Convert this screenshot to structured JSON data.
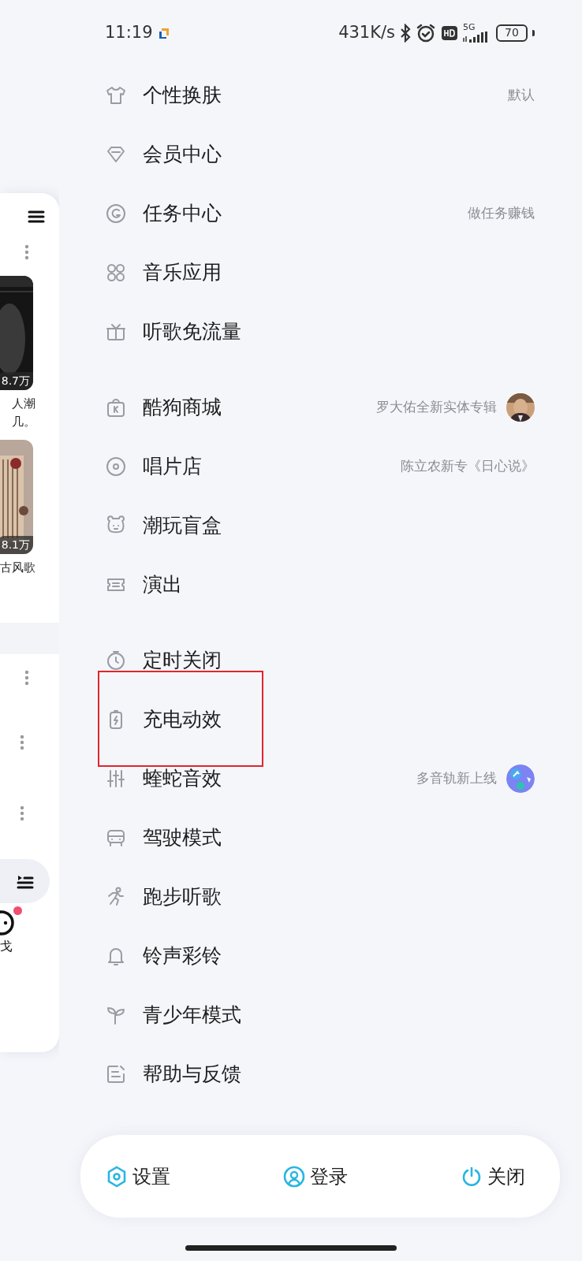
{
  "status_bar": {
    "time": "11:19",
    "net_speed": "431K/s",
    "network": "5G",
    "battery": "70"
  },
  "background_page": {
    "play_counts": [
      "8.7万",
      "8.1万"
    ],
    "captions": [
      "人潮",
      "几。",
      "古风歌"
    ],
    "tab_label": "戈",
    "tab_has_dot": true
  },
  "menu_groups": [
    [
      {
        "kind": "plain",
        "label": "个性换肤",
        "detail": "默认"
      },
      {
        "kind": "plain",
        "label": "会员中心"
      },
      {
        "kind": "plain",
        "label": "任务中心",
        "detail": "做任务赚钱"
      },
      {
        "kind": "plain",
        "label": "音乐应用"
      },
      {
        "kind": "plain",
        "label": "听歌免流量"
      }
    ],
    [
      {
        "kind": "picture",
        "label": "酷狗商城",
        "detail": "罗大佑全新实体专辑"
      },
      {
        "kind": "plain",
        "label": "唱片店",
        "detail": "陈立农新专《日心说》"
      },
      {
        "kind": "plain",
        "label": "潮玩盲盒"
      },
      {
        "kind": "plain",
        "label": "演出"
      }
    ],
    [
      {
        "kind": "plain",
        "label": "定时关闭"
      },
      {
        "kind": "plain",
        "label": "充电动效",
        "annotated": true
      },
      {
        "kind": "badge",
        "label": "蝰蛇音效",
        "detail": "多音轨新上线"
      },
      {
        "kind": "plain",
        "label": "驾驶模式"
      },
      {
        "kind": "plain",
        "label": "跑步听歌"
      },
      {
        "kind": "plain",
        "label": "铃声彩铃"
      },
      {
        "kind": "plain",
        "label": "青少年模式"
      },
      {
        "kind": "plain",
        "label": "帮助与反馈"
      }
    ]
  ],
  "bottom_bar": [
    {
      "kind": "settings",
      "label": "设置"
    },
    {
      "kind": "login",
      "label": "登录"
    },
    {
      "kind": "power",
      "label": "关闭"
    }
  ]
}
